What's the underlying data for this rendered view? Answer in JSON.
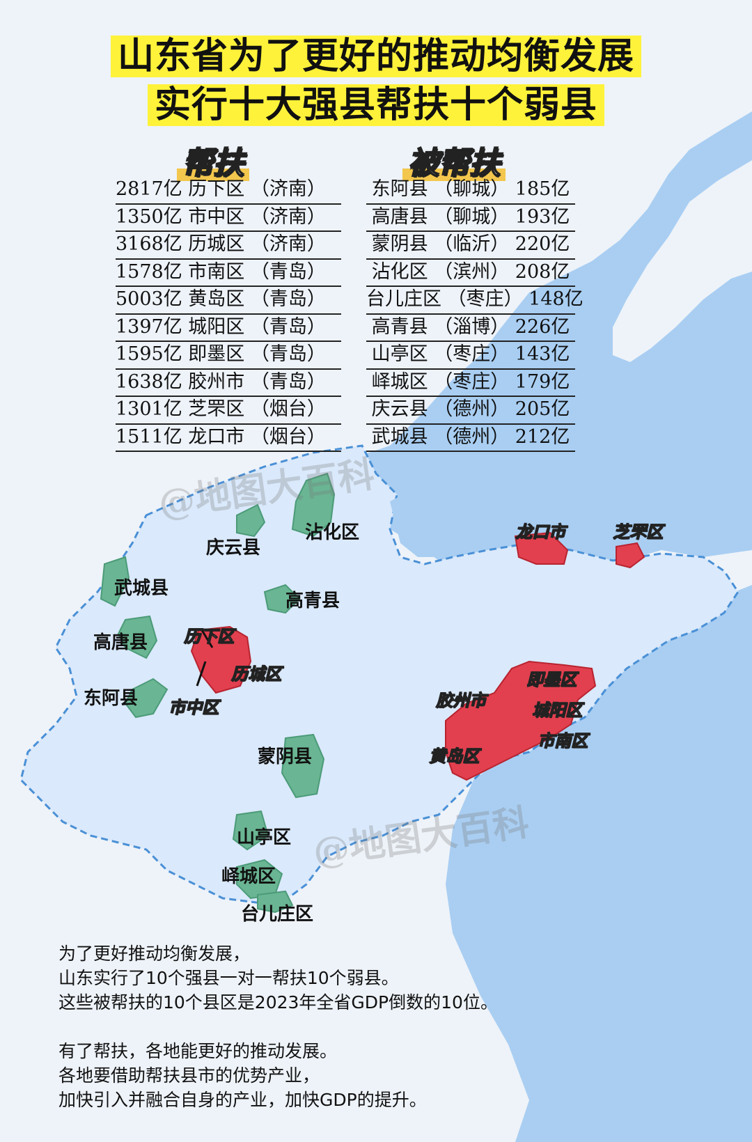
{
  "title": {
    "line1": "山东省为了更好的推动均衡发展",
    "line2": "实行十大强县帮扶十个弱县"
  },
  "table": {
    "left_header": "帮扶",
    "right_header": "被帮扶",
    "left_rows": [
      "2817亿 历下区 （济南）",
      "1350亿 市中区 （济南）",
      "3168亿 历城区 （济南）",
      "1578亿 市南区 （青岛）",
      "5003亿 黄岛区 （青岛）",
      "1397亿 城阳区 （青岛）",
      "1595亿 即墨区 （青岛）",
      "1638亿 胶州市 （青岛）",
      "1301亿 芝罘区 （烟台）",
      "1511亿 龙口市 （烟台）"
    ],
    "right_rows": [
      "东阿县 （聊城） 185亿",
      "高唐县 （聊城） 193亿",
      "蒙阴县 （临沂） 220亿",
      "沾化区 （滨州） 208亿",
      "台儿庄区 （枣庄） 148亿",
      "高青县 （淄博） 226亿",
      "山亭区 （枣庄） 143亿",
      "峄城区 （枣庄） 179亿",
      "庆云县 （德州） 205亿",
      "武城县 （德州） 212亿"
    ]
  },
  "map_labels": {
    "helped": {
      "qingyun": "庆云县",
      "zhanhua": "沾化区",
      "wucheng": "武城县",
      "gaoqing": "高青县",
      "gaotang": "高唐县",
      "donga": "东阿县",
      "mengyin": "蒙阴县",
      "shanting": "山亭区",
      "yicheng": "峄城区",
      "taierzhuang": "台儿庄区"
    },
    "helpers": {
      "lixia": "历下区",
      "licheng": "历城区",
      "shizhong": "市中区",
      "longkou": "龙口市",
      "zhifu": "芝罘区",
      "jimo": "即墨区",
      "jiaozhou": "胶州市",
      "chengyang": "城阳区",
      "shinan": "市南区",
      "huangdao": "黄岛区"
    }
  },
  "note": {
    "p1": [
      "为了更好推动均衡发展，",
      "山东实行了10个强县一对一帮扶10个弱县。",
      "这些被帮扶的10个县区是2023年全省GDP倒数的10位。"
    ],
    "p2": [
      "有了帮扶，各地能更好的推动发展。",
      "各地要借助帮扶县市的优势产业，",
      "加快引入并融合自身的产业，加快GDP的提升。"
    ]
  },
  "watermark": "@地图大百科",
  "colors": {
    "sea": "#a9cef2",
    "land": "#eef3f9",
    "province": "#dae9fb",
    "helper_red": "#e2404f",
    "helped_green": "#6ab593",
    "title_highlight": "#fff23a",
    "label_highlight": "#f3c64d"
  }
}
